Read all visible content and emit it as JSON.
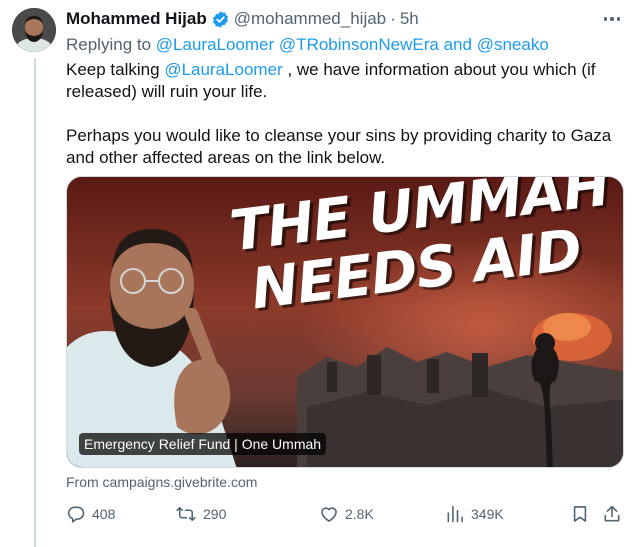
{
  "tweet": {
    "display_name": "Mohammed Hijab",
    "handle": "@mohammed_hijab",
    "separator": "·",
    "time": "5h",
    "verified": true,
    "replying_prefix": "Replying to",
    "replying_to": [
      "@LauraLoomer",
      "@TRobinsonNewEra"
    ],
    "replying_and": "and",
    "replying_last": "@sneako",
    "body_p1_before": "Keep talking",
    "body_p1_mention": "@LauraLoomer",
    "body_p1_after": ", we have information about you which (if released) will ruin your life.",
    "body_p2": "Perhaps you would like to cleanse your sins by providing charity to Gaza and other affected areas on the link below."
  },
  "card": {
    "headline_line1": "THE UMMAH",
    "headline_line2": "NEEDS AID",
    "caption": "Emergency Relief Fund | One Ummah",
    "from_text": "From campaigns.givebrite.com"
  },
  "actions": {
    "replies": "408",
    "reposts": "290",
    "likes": "2.8K",
    "views": "349K"
  },
  "icons": {
    "verified": "verified-badge-icon",
    "more": "more-dots-icon",
    "reply": "reply-icon",
    "repost": "repost-icon",
    "like": "heart-icon",
    "views": "views-chart-icon",
    "bookmark": "bookmark-icon",
    "share": "share-icon"
  },
  "colors": {
    "link": "#1d9bf0",
    "secondary_text": "#536471",
    "primary_text": "#0f1419",
    "verified": "#1d9bf0"
  }
}
